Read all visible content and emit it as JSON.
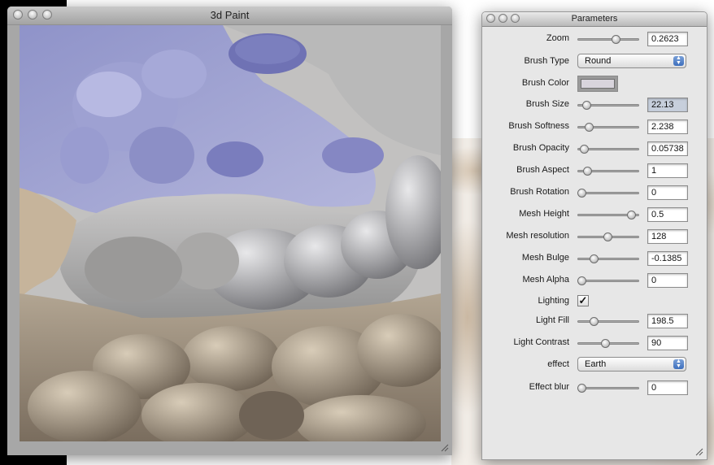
{
  "paint_window": {
    "title": "3d Paint"
  },
  "params_window": {
    "title": "Parameters",
    "rows": {
      "zoom": {
        "label": "Zoom",
        "value": "0.2623",
        "slider_pos": 0.62
      },
      "brush_type": {
        "label": "Brush Type",
        "value": "Round"
      },
      "brush_color": {
        "label": "Brush Color",
        "color": "#d8d4dc"
      },
      "brush_size": {
        "label": "Brush Size",
        "value": "22.13",
        "slider_pos": 0.13
      },
      "brush_softness": {
        "label": "Brush Softness",
        "value": "2.238",
        "slider_pos": 0.17
      },
      "brush_opacity": {
        "label": "Brush Opacity",
        "value": "0.05738",
        "slider_pos": 0.1
      },
      "brush_aspect": {
        "label": "Brush Aspect",
        "value": "1",
        "slider_pos": 0.15
      },
      "brush_rotation": {
        "label": "Brush Rotation",
        "value": "0",
        "slider_pos": 0.05
      },
      "mesh_height": {
        "label": "Mesh Height",
        "value": "0.5",
        "slider_pos": 0.88
      },
      "mesh_resolution": {
        "label": "Mesh resolution",
        "value": "128",
        "slider_pos": 0.48
      },
      "mesh_bulge": {
        "label": "Mesh Bulge",
        "value": "-0.1385",
        "slider_pos": 0.25
      },
      "mesh_alpha": {
        "label": "Mesh Alpha",
        "value": "0",
        "slider_pos": 0.05
      },
      "lighting": {
        "label": "Lighting",
        "checked": true,
        "check_glyph": "✓"
      },
      "light_fill": {
        "label": "Light Fill",
        "value": "198.5",
        "slider_pos": 0.25
      },
      "light_contrast": {
        "label": "Light Contrast",
        "value": "90",
        "slider_pos": 0.45
      },
      "effect": {
        "label": "effect",
        "value": "Earth"
      },
      "effect_blur": {
        "label": "Effect blur",
        "value": "0",
        "slider_pos": 0.05
      }
    }
  }
}
